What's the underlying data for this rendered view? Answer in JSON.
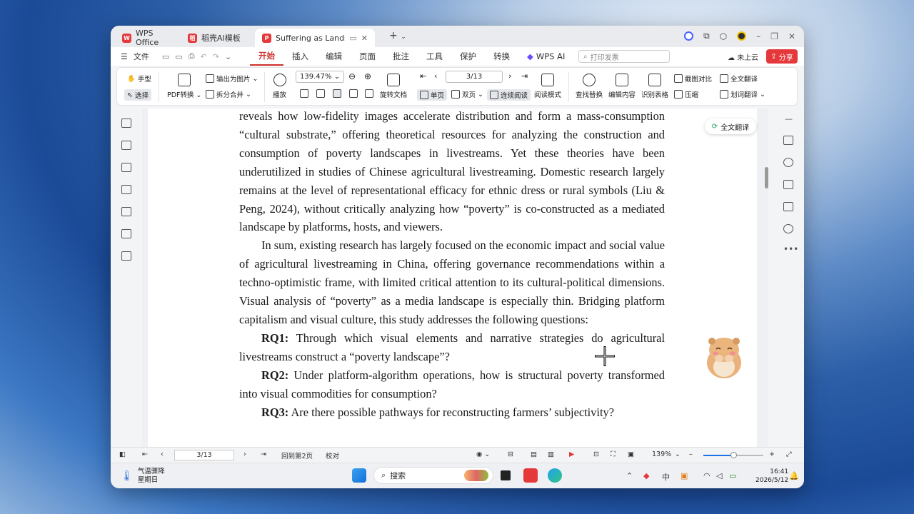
{
  "tabs": [
    {
      "label": "WPS Office",
      "color": "#e5383b",
      "icon": "wps-icon"
    },
    {
      "label": "稻壳AI模板",
      "color": "#e5383b",
      "icon": "docer-icon"
    },
    {
      "label": "Suffering as Landscape：",
      "color": "#e5383b",
      "icon": "pdf-icon"
    }
  ],
  "menubar": {
    "file_label": "文件",
    "menus": [
      "开始",
      "插入",
      "编辑",
      "页面",
      "批注",
      "工具",
      "保护",
      "转换",
      "WPS AI"
    ],
    "active_menu": "开始",
    "search_placeholder": "打印发票",
    "cloud_label": "未上云",
    "share_label": "分享"
  },
  "ribbon": {
    "hand": "手型",
    "select": "选择",
    "pdf_convert": "PDF转换",
    "export_image": "输出为图片",
    "split_merge": "拆分合并",
    "play": "播放",
    "zoom_value": "139.47%",
    "page_value": "3/13",
    "rotate": "旋转文档",
    "single_page": "单页",
    "double_page": "双页",
    "continuous": "连续阅读",
    "reading_mode": "阅读模式",
    "find_replace": "查找替换",
    "edit_content": "编辑内容",
    "recognize_table": "识别表格",
    "screenshot_compare": "截图对比",
    "compress": "压缩",
    "full_translate": "全文翻译",
    "word_translate": "划词翻译"
  },
  "document": {
    "para1": "reveals how low-fidelity images accelerate distribution and form a mass-consumption “cultural substrate,” offering theoretical resources for analyzing the construction and consumption of poverty landscapes in livestreams. Yet these theories have been underutilized in studies of Chinese agricultural livestreaming. Domestic research largely remains at the level of representational efficacy for ethnic dress or rural symbols (Liu & Peng, 2024), without critically analyzing how “poverty” is co-constructed as a mediated landscape by platforms, hosts, and viewers.",
    "para2": "In sum, existing research has largely focused on the economic impact and social value of agricultural livestreaming in China, offering governance recommendations within a techno-optimistic frame, with limited critical attention to its cultural-political dimensions. Visual analysis of “poverty” as a media landscape is especially thin. Bridging platform capitalism and visual culture, this study addresses the following questions:",
    "rq1_label": "RQ1:",
    "rq1_text": " Through which visual elements and narrative strategies do agricultural livestreams construct a “poverty landscape”?",
    "rq2_label": "RQ2:",
    "rq2_text": " Under platform-algorithm operations, how is structural poverty transformed into visual commodities for consumption?",
    "rq3_label": "RQ3:",
    "rq3_text": " Are there possible pathways for reconstructing farmers’ subjectivity?",
    "translate_button": "全文翻译"
  },
  "statusbar": {
    "page_value": "3/13",
    "back_to_page": "回到第2页",
    "proofread": "校对",
    "zoom_label": "139%",
    "zoom_fraction": 0.5
  },
  "taskbar": {
    "weather_line1": "气温骤降",
    "weather_line2": "星期日",
    "search_label": "搜索",
    "time": "16:41",
    "date": "2026/5/12"
  }
}
